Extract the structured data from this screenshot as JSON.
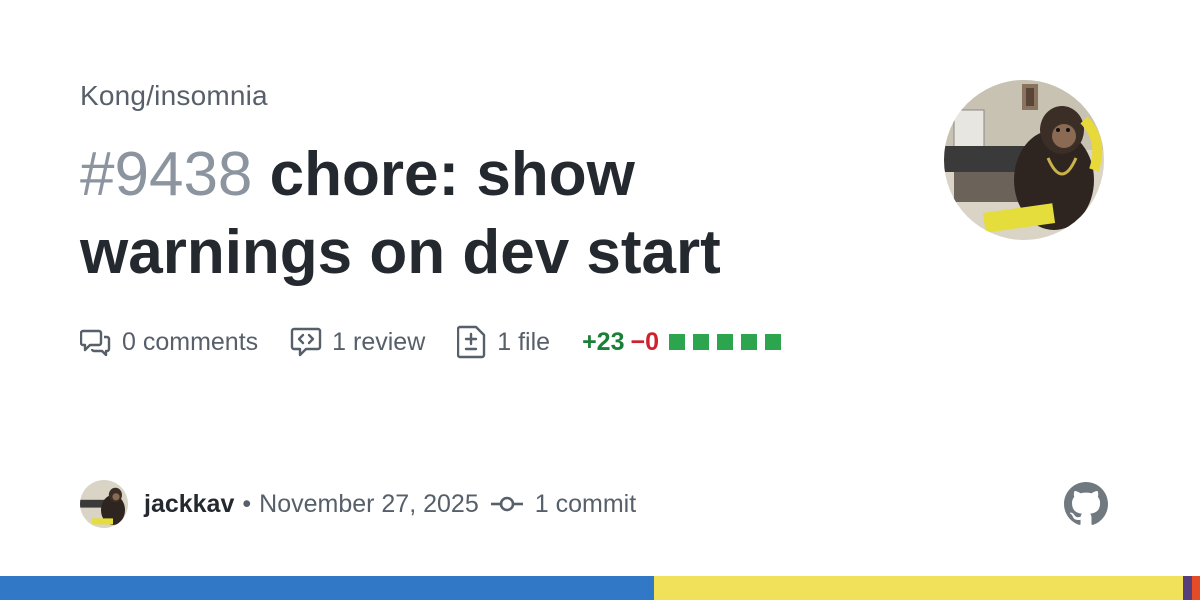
{
  "repo": {
    "full_name": "Kong/insomnia"
  },
  "pr": {
    "number": "#9438",
    "title": "chore: show warnings on dev start"
  },
  "stats": {
    "comments": "0 comments",
    "reviews": "1 review",
    "files": "1 file",
    "additions": "+23",
    "deletions": "−0",
    "diff_blocks_green_fraction": 1.0
  },
  "footer": {
    "author": "jackkav",
    "separator": "•",
    "date": "November 27, 2025",
    "commits": "1 commit"
  },
  "icons": {
    "comments": "comment-discussion-icon",
    "reviews": "code-review-icon",
    "files": "file-diff-icon",
    "commit": "git-commit-icon",
    "logo": "github-mark-icon"
  },
  "language_strip": [
    {
      "color": "#3178c6",
      "fraction": 0.545
    },
    {
      "color": "#f1e05a",
      "fraction": 0.441
    },
    {
      "color": "#563d7c",
      "fraction": 0.007
    },
    {
      "color": "#e34c26",
      "fraction": 0.007
    }
  ],
  "colors": {
    "title": "#24292f",
    "muted": "#57606a",
    "number": "#8c959f",
    "additions": "#1a7f37",
    "deletions": "#cf222e",
    "diff_block": "#2da44e"
  }
}
